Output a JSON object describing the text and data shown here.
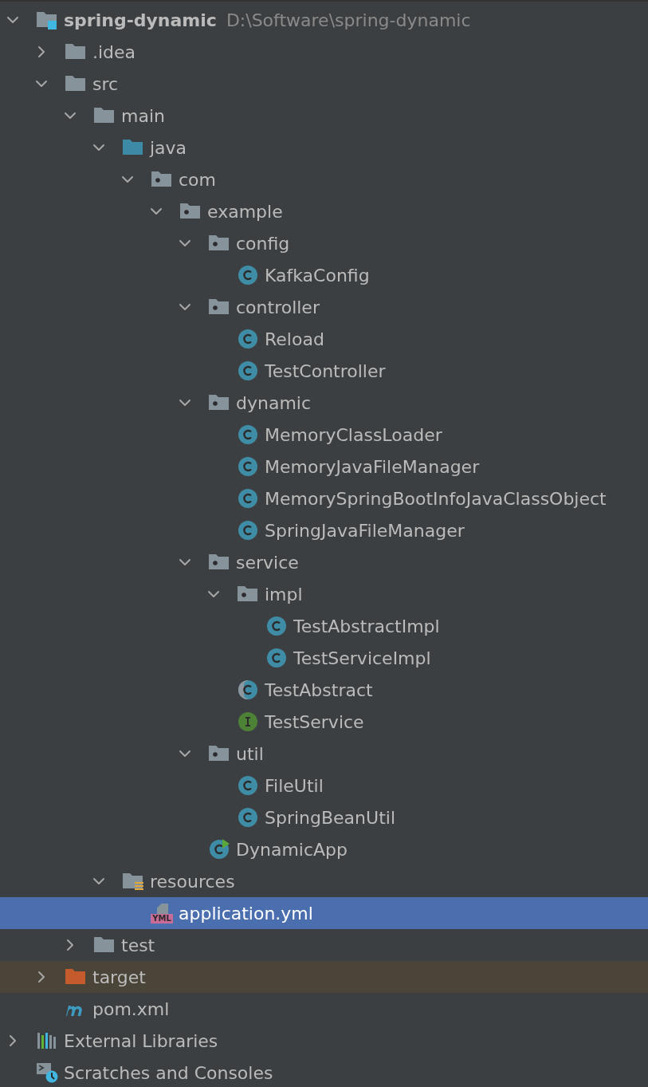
{
  "project_tree": {
    "items": [
      {
        "kind": "module",
        "label": "spring-dynamic",
        "path": "D:\\Software\\spring-dynamic",
        "expanded": true,
        "selected": false,
        "children": [
          {
            "kind": "folder",
            "label": ".idea",
            "expanded": false,
            "selected": false
          },
          {
            "kind": "folder",
            "label": "src",
            "expanded": true,
            "selected": false,
            "children": [
              {
                "kind": "folder",
                "label": "main",
                "expanded": true,
                "selected": false,
                "children": [
                  {
                    "kind": "source-folder",
                    "label": "java",
                    "expanded": true,
                    "selected": false,
                    "children": [
                      {
                        "kind": "package",
                        "label": "com",
                        "expanded": true,
                        "selected": false,
                        "children": [
                          {
                            "kind": "package",
                            "label": "example",
                            "expanded": true,
                            "selected": false,
                            "children": [
                              {
                                "kind": "package",
                                "label": "config",
                                "expanded": true,
                                "selected": false,
                                "children": [
                                  {
                                    "kind": "class",
                                    "label": "KafkaConfig",
                                    "selected": false
                                  }
                                ]
                              },
                              {
                                "kind": "package",
                                "label": "controller",
                                "expanded": true,
                                "selected": false,
                                "children": [
                                  {
                                    "kind": "class",
                                    "label": "Reload",
                                    "selected": false
                                  },
                                  {
                                    "kind": "class",
                                    "label": "TestController",
                                    "selected": false
                                  }
                                ]
                              },
                              {
                                "kind": "package",
                                "label": "dynamic",
                                "expanded": true,
                                "selected": false,
                                "children": [
                                  {
                                    "kind": "class",
                                    "label": "MemoryClassLoader",
                                    "selected": false
                                  },
                                  {
                                    "kind": "class",
                                    "label": "MemoryJavaFileManager",
                                    "selected": false
                                  },
                                  {
                                    "kind": "class",
                                    "label": "MemorySpringBootInfoJavaClassObject",
                                    "selected": false
                                  },
                                  {
                                    "kind": "class",
                                    "label": "SpringJavaFileManager",
                                    "selected": false
                                  }
                                ]
                              },
                              {
                                "kind": "package",
                                "label": "service",
                                "expanded": true,
                                "selected": false,
                                "children": [
                                  {
                                    "kind": "package",
                                    "label": "impl",
                                    "expanded": true,
                                    "selected": false,
                                    "children": [
                                      {
                                        "kind": "class",
                                        "label": "TestAbstractImpl",
                                        "selected": false
                                      },
                                      {
                                        "kind": "class",
                                        "label": "TestServiceImpl",
                                        "selected": false
                                      }
                                    ]
                                  },
                                  {
                                    "kind": "abstract-class",
                                    "label": "TestAbstract",
                                    "selected": false
                                  },
                                  {
                                    "kind": "interface",
                                    "label": "TestService",
                                    "selected": false
                                  }
                                ]
                              },
                              {
                                "kind": "package",
                                "label": "util",
                                "expanded": true,
                                "selected": false,
                                "children": [
                                  {
                                    "kind": "class",
                                    "label": "FileUtil",
                                    "selected": false
                                  },
                                  {
                                    "kind": "class",
                                    "label": "SpringBeanUtil",
                                    "selected": false
                                  }
                                ]
                              },
                              {
                                "kind": "main-class",
                                "label": "DynamicApp",
                                "selected": false
                              }
                            ]
                          }
                        ]
                      }
                    ]
                  },
                  {
                    "kind": "resources-folder",
                    "label": "resources",
                    "expanded": true,
                    "selected": false,
                    "children": [
                      {
                        "kind": "yml",
                        "label": "application.yml",
                        "badge": "YML",
                        "selected": true
                      }
                    ]
                  }
                ]
              },
              {
                "kind": "folder",
                "label": "test",
                "expanded": false,
                "selected": false
              }
            ]
          },
          {
            "kind": "excluded-folder",
            "label": "target",
            "expanded": false,
            "selected": false
          },
          {
            "kind": "maven",
            "label": "pom.xml",
            "selected": false
          }
        ]
      },
      {
        "kind": "libraries",
        "label": "External Libraries",
        "expanded": false,
        "selected": false
      },
      {
        "kind": "scratches",
        "label": "Scratches and Consoles",
        "selected": false
      }
    ]
  }
}
